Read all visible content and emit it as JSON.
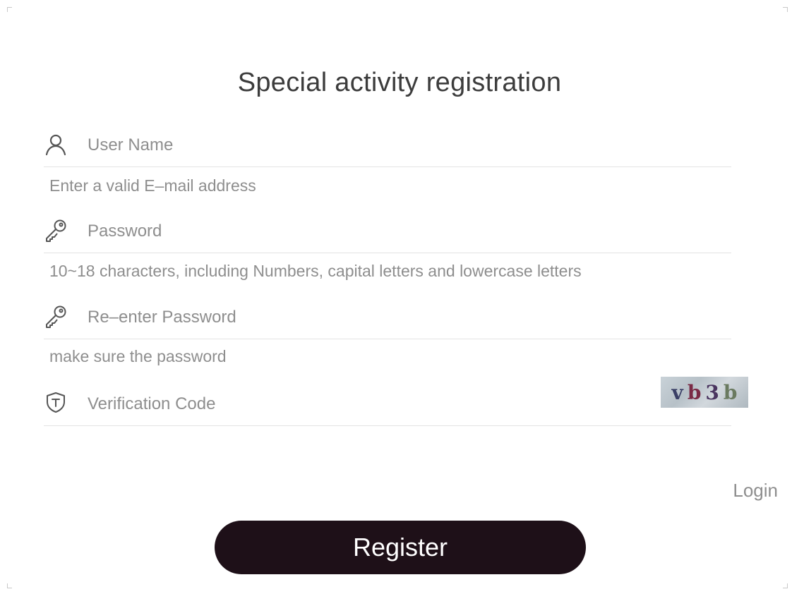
{
  "title": "Special activity registration",
  "form": {
    "username": {
      "placeholder": "User Name",
      "value": "",
      "icon": "user-icon"
    },
    "email_hint": "Enter a valid E–mail address",
    "password": {
      "placeholder": "Password",
      "value": "",
      "icon": "key-icon"
    },
    "password_hint": "10~18 characters, including Numbers, capital letters and lowercase letters",
    "confirm_password": {
      "placeholder": "Re–enter Password",
      "value": "",
      "icon": "key-icon"
    },
    "confirm_hint": "make sure the password",
    "verification": {
      "placeholder": "Verification Code",
      "value": "",
      "icon": "shield-icon"
    },
    "captcha": {
      "chars": [
        "v",
        "b",
        "3",
        "b"
      ],
      "colors": [
        "#3a3f66",
        "#7a2a45",
        "#4a3560",
        "#6a7a60"
      ]
    }
  },
  "login_label": "Login",
  "register_label": "Register",
  "colors": {
    "button_bg": "#1e1018",
    "button_text": "#ffffff",
    "placeholder": "#8e8e8e",
    "divider": "#e3e3e3"
  }
}
